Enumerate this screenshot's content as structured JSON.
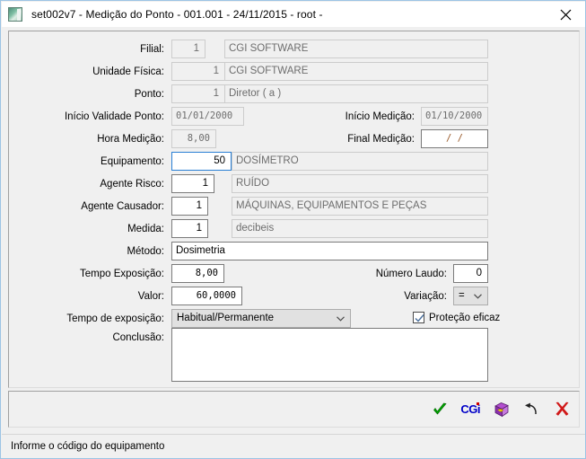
{
  "window": {
    "title": "set002v7 - Medição do Ponto - 001.001 - 24/11/2015 - root -",
    "close_label": "✕"
  },
  "form": {
    "fields": [
      {
        "label": "Filial:",
        "value": "1",
        "desc": "CGI SOFTWARE"
      },
      {
        "label": "Unidade Física:",
        "value": "1",
        "desc": "CGI SOFTWARE"
      },
      {
        "label": "Ponto:",
        "value": "1",
        "desc": "Diretor ( a )"
      },
      {
        "label": "Início Validade Ponto:",
        "value": "01/01/2000"
      },
      {
        "label": "Hora Medição:",
        "value": "8,00"
      },
      {
        "label": "Equipamento:",
        "value": "50",
        "desc": "DOSÍMETRO"
      },
      {
        "label": "Agente Risco:",
        "value": "1",
        "desc": "RUÍDO"
      },
      {
        "label": "Agente Causador:",
        "value": "1",
        "desc": "MÁQUINAS, EQUIPAMENTOS E PEÇAS"
      },
      {
        "label": "Medida:",
        "value": "1",
        "desc": "decibeis"
      },
      {
        "label": "Método:",
        "value": "Dosimetria"
      },
      {
        "label": "Tempo Exposição:",
        "value": "8,00"
      },
      {
        "label": "Valor:",
        "value": "60,0000"
      },
      {
        "label": "Tempo de exposição:",
        "value": "Habitual/Permanente"
      },
      {
        "label": "Conclusão:",
        "value": ""
      }
    ],
    "right_fields": [
      {
        "label": "Início Medição:",
        "value": "01/10/2000"
      },
      {
        "label": "Final Medição:",
        "value": "/        /"
      },
      {
        "label": "Número Laudo:",
        "value": "0"
      },
      {
        "label": "Variação:",
        "value": "="
      }
    ],
    "checkbox": {
      "label": "Proteção eficaz",
      "checked": "true"
    }
  },
  "toolbar": {
    "confirm_label": "✔",
    "logo_label": "CGi",
    "package_label": "pacote",
    "undo_label": "desfazer",
    "cancel_label": "✖"
  },
  "statusbar": {
    "message": "Informe o código do equipamento"
  },
  "colors": {
    "accent": "#2a7fd4",
    "frame": "#9cc4e4",
    "confirm": "#00a000",
    "cancel": "#d02020",
    "logo": "#0000c8"
  }
}
